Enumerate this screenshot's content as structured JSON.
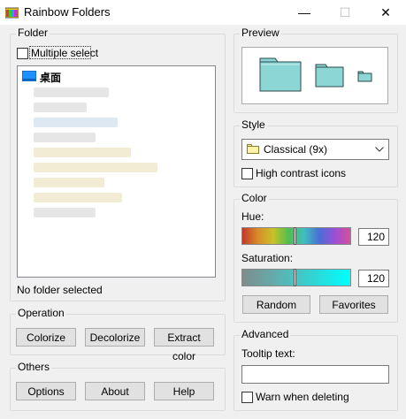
{
  "window": {
    "title": "Rainbow Folders",
    "minimize_glyph": "—",
    "maximize_glyph": "☐",
    "close_glyph": "✕"
  },
  "folder_group": {
    "title": "Folder",
    "multiple_select_label": "Multiple select",
    "tree_root": "桌面",
    "status": "No folder selected"
  },
  "operation_group": {
    "title": "Operation",
    "colorize": "Colorize",
    "decolorize": "Decolorize",
    "extract_color": "Extract color"
  },
  "others_group": {
    "title": "Others",
    "options": "Options",
    "about": "About",
    "help": "Help"
  },
  "preview_group": {
    "title": "Preview",
    "folder_color": "#8dd6d6"
  },
  "style_group": {
    "title": "Style",
    "selected_style": "Classical (9x)",
    "high_contrast_label": "High contrast icons"
  },
  "color_group": {
    "title": "Color",
    "hue_label": "Hue:",
    "hue_value": "120",
    "saturation_label": "Saturation:",
    "saturation_value": "120",
    "random": "Random",
    "favorites": "Favorites"
  },
  "advanced_group": {
    "title": "Advanced",
    "tooltip_label": "Tooltip text:",
    "tooltip_value": "",
    "warn_label": "Warn when deleting"
  }
}
